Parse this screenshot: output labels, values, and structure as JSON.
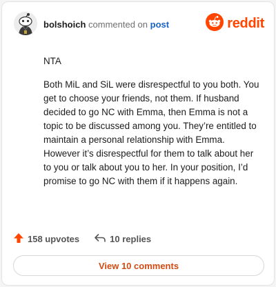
{
  "header": {
    "author": "bolshoich",
    "action_text": "commented on",
    "post_link": "post",
    "brand": "reddit",
    "avatar_icon": "snoo-avatar-icon",
    "brand_icon": "reddit-logo-icon"
  },
  "comment": {
    "paragraphs": [
      "NTA",
      "Both MiL and SiL were disrespectful to you both. You get to choose your friends, not them. If husband decided to go NC with Emma, then Emma is not a topic to be discussed among you. They’re entitled to maintain a personal relationship with Emma. However it’s disrespectful for them to talk about her to you or talk about you to her. In your position, I’d promise to go NC with them if it happens again."
    ]
  },
  "actions": {
    "upvotes": "158 upvotes",
    "replies": "10 replies",
    "upvote_icon": "upvote-arrow-icon",
    "reply_icon": "reply-arrow-icon"
  },
  "view_button": "View 10 comments",
  "colors": {
    "brand": "#ff4500",
    "link": "#1a63c6",
    "button_text": "#d14a12"
  }
}
